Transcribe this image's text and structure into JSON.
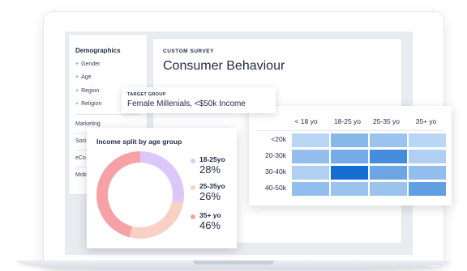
{
  "sidebar": {
    "section_title": "Demographics",
    "items": [
      "Gender",
      "Age",
      "Region",
      "Religion"
    ],
    "categories": [
      "Marketing",
      "Soci",
      "eCo",
      "Mob"
    ]
  },
  "survey": {
    "kicker": "CUSTOM SURVEY",
    "title": "Consumer Behaviour"
  },
  "target_group": {
    "label": "TARGET GROUP",
    "value": "Female Millenials, <$50k Income"
  },
  "donut": {
    "title": "Income split by age group"
  },
  "heatmap": {
    "columns": [
      "< 18 yo",
      "18-25 yo",
      "25-35 yo",
      "35+ yo"
    ],
    "rows": [
      "<20k",
      "20-30k",
      "30-40k",
      "40-50k"
    ]
  },
  "colors": {
    "accent": "#4a7bd1",
    "seg_18_25": "#dcc8f8",
    "seg_25_35": "#fbd0c4",
    "seg_35_plus": "#f6a1a6"
  },
  "chart_data": [
    {
      "type": "pie",
      "title": "Income split by age group",
      "categories": [
        "18-25yo",
        "25-35yo",
        "35+ yo"
      ],
      "values": [
        28,
        26,
        46
      ],
      "value_labels": [
        "28%",
        "26%",
        "46%"
      ],
      "colors": [
        "#dcc8f8",
        "#fbd0c4",
        "#f6a1a6"
      ]
    },
    {
      "type": "heatmap",
      "x": [
        "< 18 yo",
        "18-25 yo",
        "25-35 yo",
        "35+ yo"
      ],
      "y": [
        "<20k",
        "20-30k",
        "30-40k",
        "40-50k"
      ],
      "values": [
        [
          0.15,
          0.4,
          0.3,
          0.15
        ],
        [
          0.35,
          0.5,
          0.75,
          0.2
        ],
        [
          0.2,
          1.0,
          0.55,
          0.35
        ],
        [
          0.35,
          0.3,
          0.3,
          0.6
        ]
      ]
    }
  ]
}
